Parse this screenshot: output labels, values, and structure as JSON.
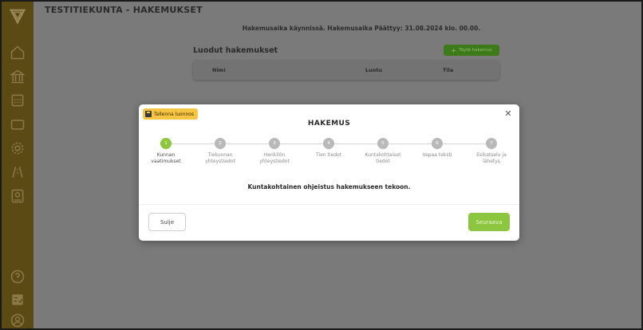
{
  "app": {
    "title": "TESTITIEKUNTA - HAKEMUKSET"
  },
  "sidebar": {
    "items": [
      {
        "icon": "home-icon"
      },
      {
        "icon": "bank-icon"
      },
      {
        "icon": "calendar-icon"
      },
      {
        "icon": "folder-icon"
      },
      {
        "icon": "gear-icon"
      },
      {
        "icon": "road-icon"
      },
      {
        "icon": "id-card-icon"
      }
    ],
    "bottom_items": [
      {
        "icon": "help-icon"
      },
      {
        "icon": "checklist-icon"
      },
      {
        "icon": "user-icon"
      }
    ]
  },
  "header": {
    "status": "Hakemusaika käynnissä. Hakemusaika Päättyy: 31.08.2024 klo. 00.00."
  },
  "list": {
    "title": "Luodut hakemukset",
    "new_button": "Täytä hakemus",
    "columns": [
      "Nimi",
      "Luotu",
      "Tila"
    ]
  },
  "modal": {
    "save_draft": "Tallenna luonnos",
    "title": "HAKEMUS",
    "steps": [
      {
        "number": "1",
        "label_line1": "Kunnan",
        "label_line2": "vaatimukset"
      },
      {
        "number": "2",
        "label_line1": "Tiekunnan",
        "label_line2": "yhteystiedot"
      },
      {
        "number": "3",
        "label_line1": "Henkilön",
        "label_line2": "yhteystiedot"
      },
      {
        "number": "4",
        "label_line1": "Tien tiedot",
        "label_line2": ""
      },
      {
        "number": "5",
        "label_line1": "Kuntakohtaiset",
        "label_line2": "tiedot"
      },
      {
        "number": "6",
        "label_line1": "Vapaa teksti",
        "label_line2": ""
      },
      {
        "number": "7",
        "label_line1": "Esikatselu ja",
        "label_line2": "lähetys"
      }
    ],
    "active_step": 1,
    "instructions": "Kuntakohtainen ohjeistus hakemukseen tekoon.",
    "close_label": "Sulje",
    "next_label": "Seuraava"
  },
  "colors": {
    "accent_green": "#8cc63f",
    "draft_yellow": "#f7c544",
    "sidebar": "#5c4a14"
  }
}
